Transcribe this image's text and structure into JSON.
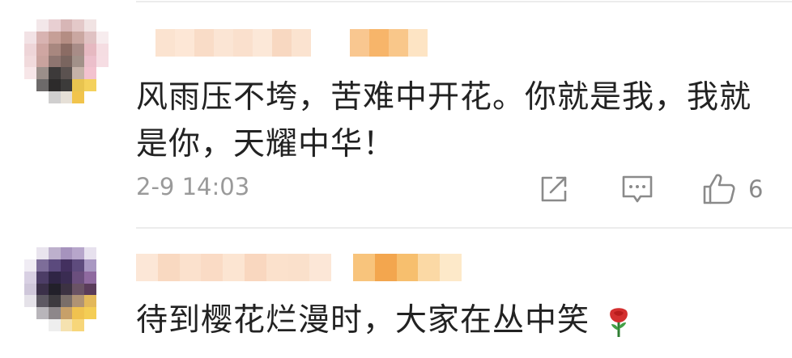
{
  "comments": [
    {
      "username_hidden": true,
      "text": "风雨压不垮，苦难中开花。你就是我，我就是你，天耀中华！",
      "timestamp": "2-9 14:03",
      "likes": "6",
      "icons": {
        "share": "share-icon",
        "comment": "comment-icon",
        "like": "thumbs-up-icon"
      }
    },
    {
      "username_hidden": true,
      "text": "待到樱花烂漫时，大家在丛中笑",
      "emoji": "rose-icon"
    }
  ],
  "colors": {
    "text": "#222222",
    "muted": "#9a9a9a",
    "divider": "#ececec"
  }
}
